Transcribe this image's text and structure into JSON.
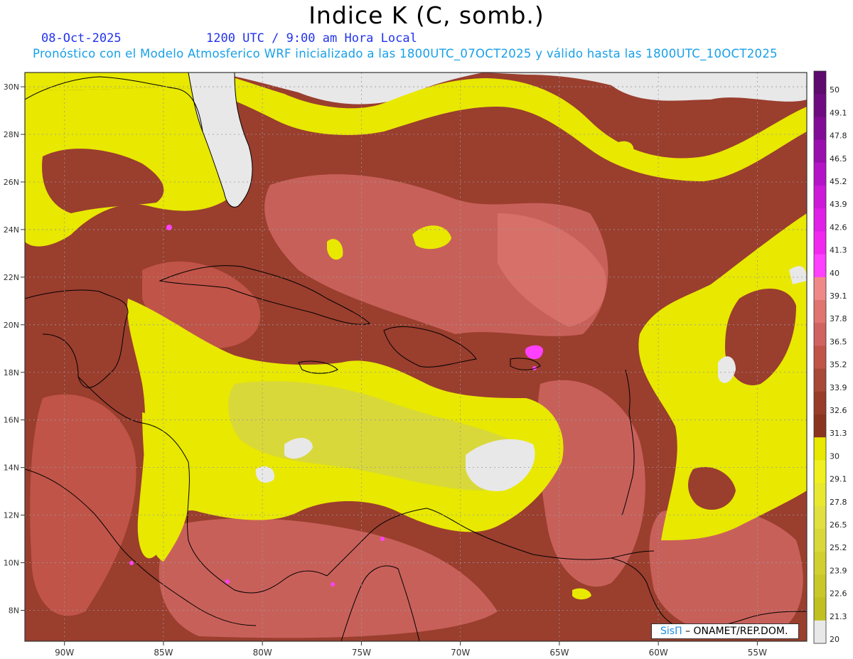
{
  "header": {
    "title": "Indice K (C, somb.)",
    "date": "08-Oct-2025",
    "time": "1200 UTC / 9:00 am Hora Local",
    "description": "Pronóstico con el Modelo Atmosferico WRF inicializado a las 1800UTC_07OCT2025 y válido hasta las  1800UTC_10OCT2025"
  },
  "map": {
    "lon_range": [
      -92,
      -52.5
    ],
    "lat_range": [
      6.7,
      30.6
    ],
    "lon_ticks": [
      "90W",
      "85W",
      "80W",
      "75W",
      "70W",
      "65W",
      "60W",
      "55W"
    ],
    "lon_values": [
      -90,
      -85,
      -80,
      -75,
      -70,
      -65,
      -60,
      -55
    ],
    "lat_ticks": [
      "30N",
      "28N",
      "26N",
      "24N",
      "22N",
      "20N",
      "18N",
      "16N",
      "14N",
      "12N",
      "10N",
      "8N"
    ],
    "lat_values": [
      30,
      28,
      26,
      24,
      22,
      20,
      18,
      16,
      14,
      12,
      10,
      8
    ],
    "grid": true
  },
  "colorbar": {
    "labels": [
      "50",
      "49.1",
      "47.8",
      "46.5",
      "45.2",
      "43.9",
      "42.6",
      "41.3",
      "40",
      "39.1",
      "37.8",
      "36.5",
      "35.2",
      "33.9",
      "32.6",
      "31.3",
      "30",
      "29.1",
      "27.8",
      "26.5",
      "25.2",
      "23.9",
      "22.6",
      "21.3",
      "20"
    ],
    "colors": [
      "#5e0a6e",
      "#6e0b80",
      "#820c96",
      "#9a0eaf",
      "#b414c8",
      "#cc1ad8",
      "#e020e6",
      "#f028f0",
      "#ff40ff",
      "#f08888",
      "#e07470",
      "#d06260",
      "#c05448",
      "#a84838",
      "#983c2c",
      "#8a3420",
      "#e8e800",
      "#f0f020",
      "#e8e830",
      "#e0e040",
      "#d8d83a",
      "#d0d030",
      "#c8c828",
      "#c0c020",
      "#e8e8e8"
    ]
  },
  "credit": {
    "brand": "SisΠ",
    "rest": "– ONAMET/REP.DOM."
  }
}
